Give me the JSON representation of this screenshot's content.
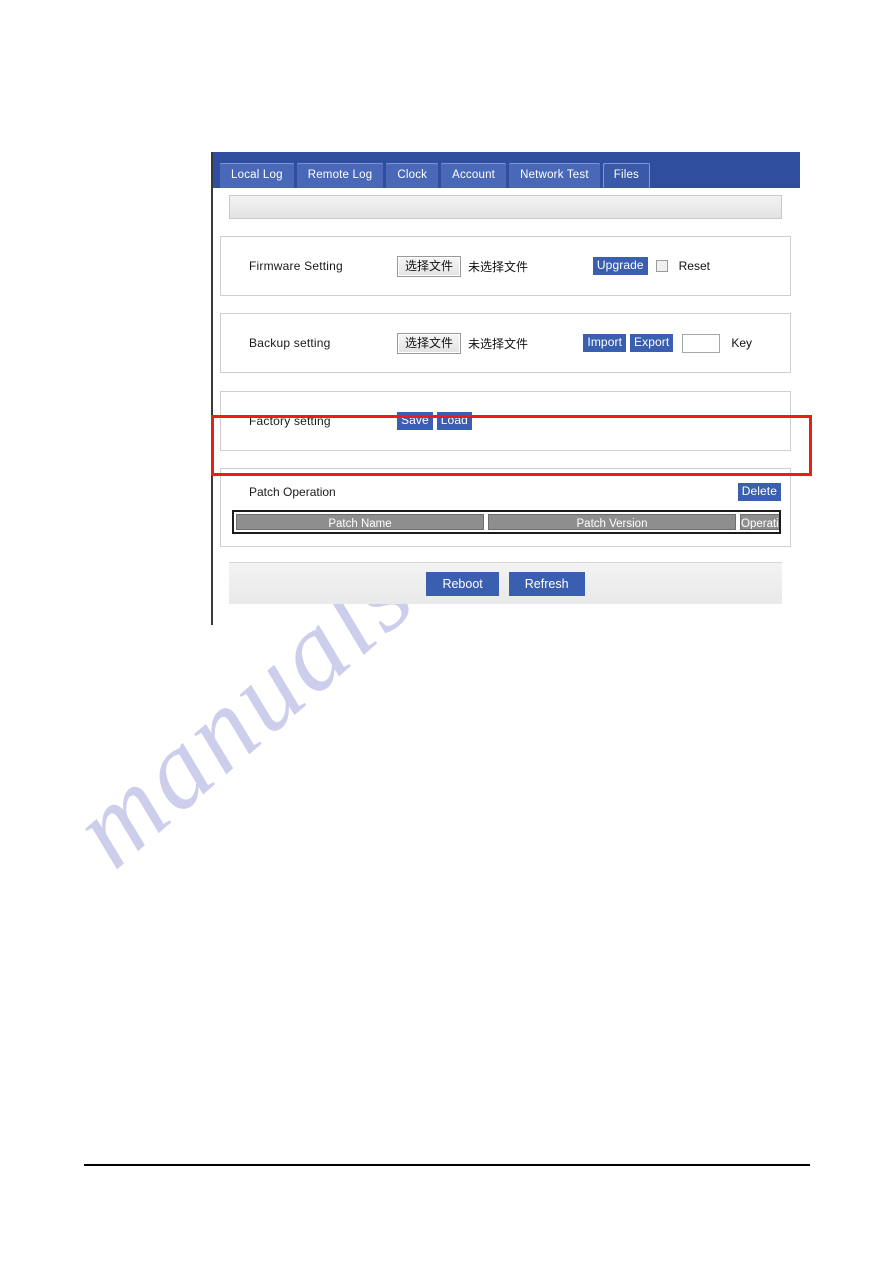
{
  "tabs": [
    {
      "label": "Local Log",
      "active": false
    },
    {
      "label": "Remote Log",
      "active": false
    },
    {
      "label": "Clock",
      "active": false
    },
    {
      "label": "Account",
      "active": false
    },
    {
      "label": "Network Test",
      "active": false
    },
    {
      "label": "Files",
      "active": true
    }
  ],
  "firmware": {
    "label": "Firmware Setting",
    "file_button": "选择文件",
    "file_status": "未选择文件",
    "upgrade_button": "Upgrade",
    "reset_label": "Reset",
    "reset_checked": false
  },
  "backup": {
    "label": "Backup setting",
    "file_button": "选择文件",
    "file_status": "未选择文件",
    "import_button": "Import",
    "export_button": "Export",
    "key_value": "",
    "key_label": "Key"
  },
  "factory": {
    "label": "Factory setting",
    "save_button": "Save",
    "load_button": "Load",
    "highlighted": true
  },
  "patch": {
    "title": "Patch Operation",
    "delete_button": "Delete",
    "columns": [
      "Patch Name",
      "Patch Version",
      "Operation"
    ],
    "rows": []
  },
  "footer_actions": {
    "reboot_button": "Reboot",
    "refresh_button": "Refresh"
  },
  "watermark": {
    "text": "manualshive.com"
  },
  "colors": {
    "tabbar_bg": "#2f4f9e",
    "tab_bg": "#4a68b8",
    "tab_active_bg": "#3a5aa8",
    "button_blue": "#3a5fb0",
    "highlight_red": "#ee1b1b",
    "table_header_gray": "#8e8e8e",
    "watermark_color": "#b9bce6"
  }
}
